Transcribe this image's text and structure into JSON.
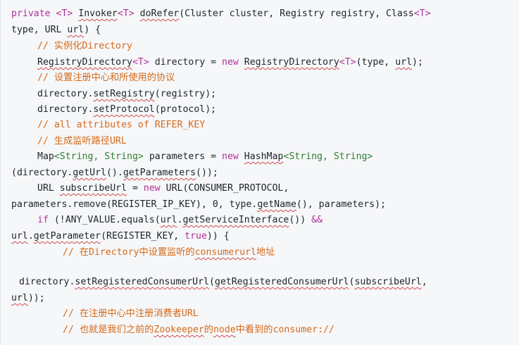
{
  "lines": [
    {
      "id": "l1",
      "parts": [
        [
          "kw",
          "private "
        ],
        [
          "gen",
          "<T> "
        ],
        [
          "sq",
          "Invoker"
        ],
        [
          "gen",
          "<T> "
        ],
        [
          "sq",
          "doRefer"
        ],
        [
          "",
          "(Cluster cluster, Registry registry, Class"
        ],
        [
          "gen",
          "<T>"
        ]
      ]
    },
    {
      "id": "l2",
      "parts": [
        [
          "",
          "type, URL "
        ],
        [
          "sq",
          "url"
        ],
        [
          "",
          ") {"
        ]
      ]
    },
    {
      "id": "l3",
      "parts": [
        [
          "cmt",
          "// 实例化Directory"
        ]
      ]
    },
    {
      "id": "l4",
      "parts": [
        [
          "sq",
          "RegistryDirectory"
        ],
        [
          "gen",
          "<T>"
        ],
        [
          "",
          " directory = "
        ],
        [
          "kw",
          "new "
        ],
        [
          "sq",
          "RegistryDirectory"
        ],
        [
          "gen",
          "<T>"
        ],
        [
          "",
          "(type, "
        ],
        [
          "sq",
          "url"
        ],
        [
          "",
          ");"
        ]
      ]
    },
    {
      "id": "l5",
      "parts": [
        [
          "cmt",
          "// 设置注册中心和所使用的协议"
        ]
      ]
    },
    {
      "id": "l6",
      "parts": [
        [
          "",
          "directory."
        ],
        [
          "sq",
          "setRegistry"
        ],
        [
          "",
          "(registry);"
        ]
      ]
    },
    {
      "id": "l7",
      "parts": [
        [
          "",
          "directory."
        ],
        [
          "sq",
          "setProtocol"
        ],
        [
          "",
          "(protocol);"
        ]
      ]
    },
    {
      "id": "l8",
      "parts": [
        [
          "cmt",
          "// all attributes of REFER_KEY"
        ]
      ]
    },
    {
      "id": "l9",
      "parts": [
        [
          "cmt",
          "// 生成监听路径URL"
        ]
      ]
    },
    {
      "id": "l10",
      "parts": [
        [
          "",
          "Map"
        ],
        [
          "str",
          "<String, String>"
        ],
        [
          "",
          " parameters = "
        ],
        [
          "kw",
          "new "
        ],
        [
          "sq",
          "HashMap"
        ],
        [
          "str",
          "<String, String>"
        ]
      ]
    },
    {
      "id": "l11",
      "parts": [
        [
          "",
          "(directory."
        ],
        [
          "sq",
          "getUrl"
        ],
        [
          "",
          "()."
        ],
        [
          "sq",
          "getParameters"
        ],
        [
          "",
          "());"
        ]
      ]
    },
    {
      "id": "l12",
      "parts": [
        [
          "",
          "URL "
        ],
        [
          "sq",
          "subscribeUrl"
        ],
        [
          "",
          " = "
        ],
        [
          "kw",
          "new "
        ],
        [
          "",
          "URL(CONSUMER_PROTOCOL,"
        ]
      ]
    },
    {
      "id": "l13",
      "parts": [
        [
          "",
          "parameters.remove(REGISTER_IP_KEY), 0, type."
        ],
        [
          "sq",
          "getName"
        ],
        [
          "",
          "(), parameters);"
        ]
      ]
    },
    {
      "id": "l14",
      "parts": [
        [
          "kw",
          "if "
        ],
        [
          "",
          "(!ANY_VALUE.equals("
        ],
        [
          "sq",
          "url"
        ],
        [
          "",
          "."
        ],
        [
          "sq",
          "getServiceInterface"
        ],
        [
          "",
          "()) "
        ],
        [
          "kw",
          "&&"
        ]
      ]
    },
    {
      "id": "l15",
      "parts": [
        [
          "sq",
          "url"
        ],
        [
          "",
          "."
        ],
        [
          "sq",
          "getParameter"
        ],
        [
          "",
          "(REGISTER_KEY, "
        ],
        [
          "kw",
          "true"
        ],
        [
          "",
          ")) {"
        ]
      ]
    },
    {
      "id": "l16",
      "parts": [
        [
          "cmt",
          "// 在Directory中设置监听的"
        ],
        [
          "cmt sq",
          "consumerurl"
        ],
        [
          "cmt",
          "地址"
        ]
      ]
    },
    {
      "id": "l17",
      "parts": [
        [
          "",
          "directory."
        ],
        [
          "sq",
          "setRegisteredConsumerUrl"
        ],
        [
          "",
          "("
        ],
        [
          "sq",
          "getRegisteredConsumerUrl"
        ],
        [
          "",
          "("
        ],
        [
          "sq",
          "subscribeUrl"
        ],
        [
          "",
          ","
        ]
      ]
    },
    {
      "id": "l18",
      "parts": [
        [
          "sq",
          "url"
        ],
        [
          "",
          "));"
        ]
      ]
    },
    {
      "id": "l19",
      "parts": [
        [
          "cmt",
          "// 在注册中心中注册消费者URL"
        ]
      ]
    },
    {
      "id": "l20",
      "parts": [
        [
          "cmt",
          "// 也就是我们之前的"
        ],
        [
          "cmt sq",
          "Zookeeper"
        ],
        [
          "cmt",
          "的"
        ],
        [
          "cmt sq",
          "node"
        ],
        [
          "cmt",
          "中看到的consumer://"
        ]
      ]
    }
  ]
}
